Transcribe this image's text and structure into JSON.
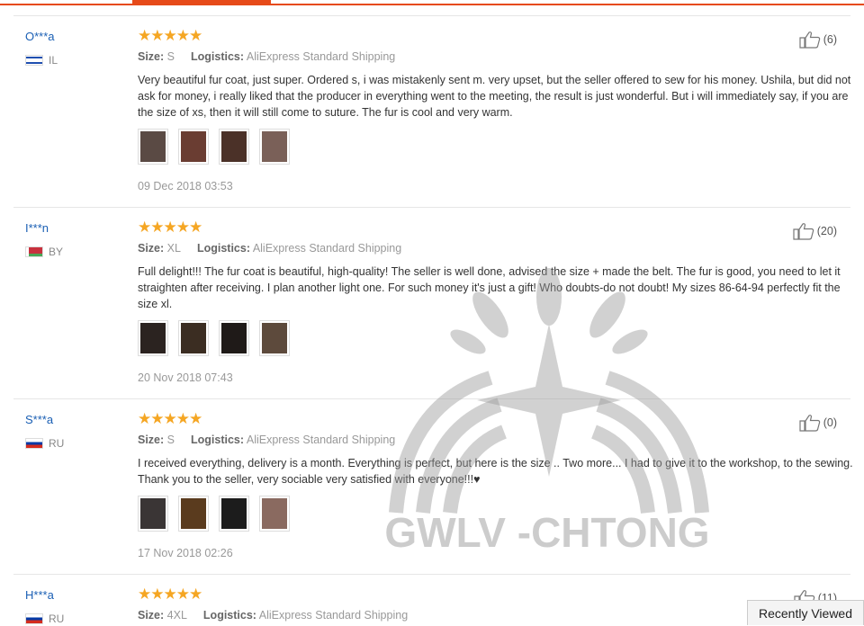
{
  "reviews": [
    {
      "user": "O***a",
      "country": "IL",
      "flag": "il",
      "size_label": "Size:",
      "size": "S",
      "logistics_label": "Logistics:",
      "logistics": "AliExpress Standard Shipping",
      "text": "Very beautiful fur coat, just super. Ordered s, i was mistakenly sent m. very upset, but the seller offered to sew for his money. Ushila, but did not ask for money, i really liked that the producer in everything went to the meeting, the result is just wonderful. But i will immediately say, if you are the size of xs, then it will still come to suture. The fur is cool and very warm.",
      "likes": "(6)",
      "date": "09 Dec 2018 03:53",
      "photos": [
        "#5a4a44",
        "#6a3d32",
        "#4b3128",
        "#7a6058"
      ]
    },
    {
      "user": "I***n",
      "country": "BY",
      "flag": "by",
      "size_label": "Size:",
      "size": "XL",
      "logistics_label": "Logistics:",
      "logistics": "AliExpress Standard Shipping",
      "text": "Full delight!!! The fur coat is beautiful, high-quality! The seller is well done, advised the size + made the belt. The fur is good, you need to let it straighten after receiving. I plan another light one. For such money it's just a gift! Who doubts-do not doubt! My sizes 86-64-94 perfectly fit the size xl.",
      "likes": "(20)",
      "date": "20 Nov 2018 07:43",
      "photos": [
        "#2b2320",
        "#3b2d22",
        "#1f1a18",
        "#5d4a3c"
      ]
    },
    {
      "user": "S***a",
      "country": "RU",
      "flag": "ru",
      "size_label": "Size:",
      "size": "S",
      "logistics_label": "Logistics:",
      "logistics": "AliExpress Standard Shipping",
      "text": "I received everything, delivery is a month. Everything is perfect, but here is the size .. Two more... I had to give it to the workshop, to the sewing. Thank you to the seller, very sociable very satisfied with everyone!!!♥",
      "likes": "(0)",
      "date": "17 Nov 2018 02:26",
      "photos": [
        "#3a3535",
        "#5a3b1e",
        "#1c1c1c",
        "#8a6a60"
      ]
    },
    {
      "user": "H***a",
      "country": "RU",
      "flag": "ru",
      "size_label": "Size:",
      "size": "4XL",
      "logistics_label": "Logistics:",
      "logistics": "AliExpress Standard Shipping",
      "text": "",
      "likes": "(11)",
      "date": "",
      "photos": []
    }
  ],
  "stars": "★★★★★",
  "watermark_text": "GWLV -CHTONG",
  "recently_viewed": "Recently Viewed",
  "colors": {
    "accent": "#e64a19",
    "star": "#f5a623",
    "user": "#1a5fb4"
  }
}
